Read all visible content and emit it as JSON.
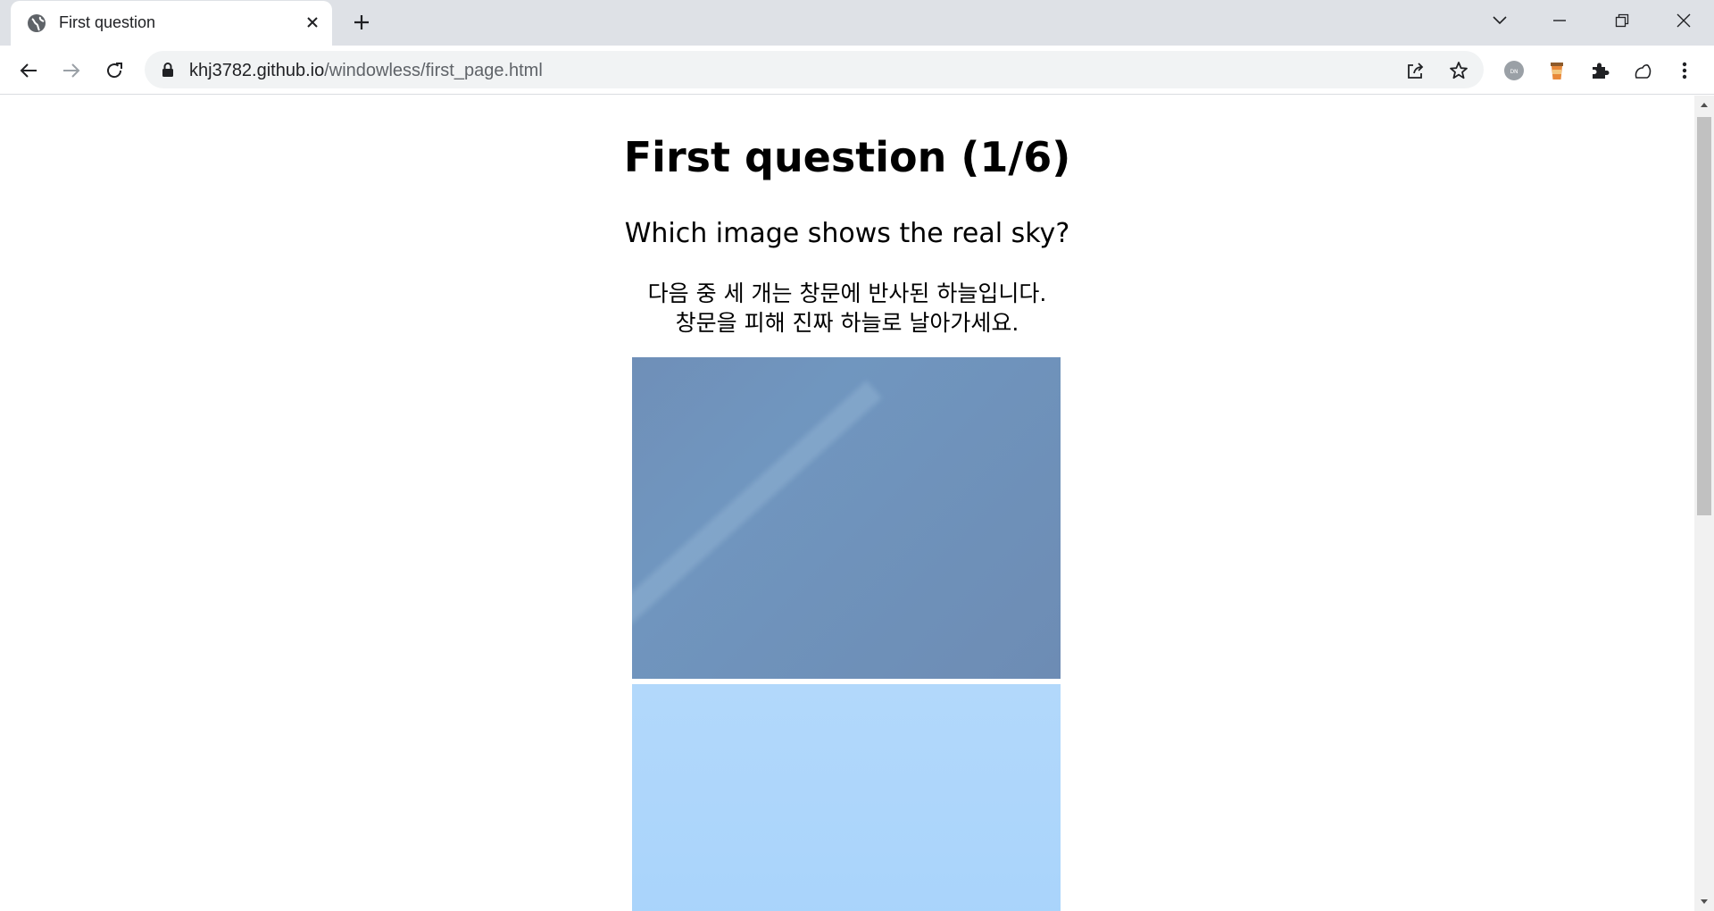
{
  "browser": {
    "tab_title": "First question",
    "url_host": "khj3782.github.io",
    "url_path": "/windowless/first_page.html",
    "icons": [
      "globe-icon",
      "close-icon",
      "plus-icon",
      "chevron-down-icon",
      "minimize-icon",
      "restore-icon",
      "window-close-icon",
      "back-icon",
      "forward-icon",
      "reload-icon",
      "lock-icon",
      "share-icon",
      "star-icon",
      "extension-icon",
      "puzzle-icon",
      "profile-icon",
      "menu-icon"
    ]
  },
  "page": {
    "title": "First question (1/6)",
    "question": "Which image shows the real sky?",
    "instruction_line1": "다음 중 세 개는 창문에 반사된 하늘입니다.",
    "instruction_line2": "창문을 피해 진짜 하늘로 날아가세요."
  },
  "colors": {
    "tab_strip": "#dee1e6",
    "omnibox": "#f1f3f4",
    "sky_image_1": "#6f8fb8",
    "sky_image_2": "#b2d8fb"
  }
}
